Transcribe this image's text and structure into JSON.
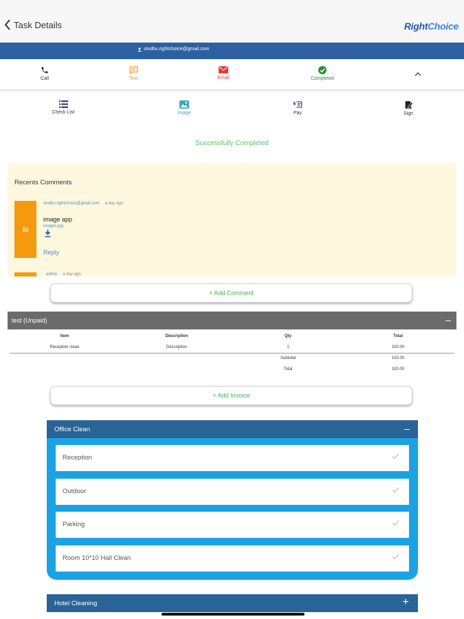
{
  "nav": {
    "back_label": "Task Details",
    "logo_part1": "Right",
    "logo_part2": "Choice"
  },
  "contact": {
    "email": "sindhu.rightchoice@gmail.com"
  },
  "actions": [
    {
      "label": "Call",
      "icon": "phone-icon",
      "color": "#333333"
    },
    {
      "label": "Text",
      "icon": "message-icon",
      "color": "#f28c1e"
    },
    {
      "label": "Email",
      "icon": "mail-icon",
      "color": "#e53935"
    },
    {
      "label": "Completed",
      "icon": "check-circle-icon",
      "color": "#2e8b3a"
    }
  ],
  "tools": [
    {
      "label": "Check List",
      "icon": "list-icon"
    },
    {
      "label": "Image",
      "icon": "image-icon",
      "active_color": "#3aa6c8"
    },
    {
      "label": "Pay",
      "icon": "pay-icon"
    },
    {
      "label": "Sign",
      "icon": "sign-icon"
    }
  ],
  "status_text": "Successfully Completed",
  "comments": {
    "title": "Recents Comments",
    "items": [
      {
        "initials": "SI",
        "author": "sindhu.rightchoice@gmail.com",
        "time": "a day ago",
        "text": "image app",
        "file": "images.jpg",
        "reply_label": "Reply"
      },
      {
        "author": "admin",
        "time": "a day ago"
      }
    ]
  },
  "add_comment_label": "+ Add Comment",
  "invoice": {
    "title": "test (Unpaid)",
    "columns": [
      "Item",
      "Description",
      "Qty",
      "Total"
    ],
    "rows": [
      {
        "item": "Reception clean",
        "description": "Description",
        "qty": "1",
        "total": "100.00"
      }
    ],
    "subtotal_label": "Subtotal",
    "subtotal_value": "100.00",
    "total_label": "Total",
    "total_value": "100.00"
  },
  "add_invoice_label": "+ Add Invoice",
  "checklists": [
    {
      "title": "Office Clean",
      "expanded": true,
      "tasks": [
        "Reception",
        "Outdoor",
        "Parking",
        "Room 10*10 Hall Clean"
      ]
    },
    {
      "title": "Hotel Cleaning",
      "expanded": false
    }
  ],
  "colors": {
    "brand_blue": "#2d5fa3",
    "panel_header": "#2a6396",
    "panel_body": "#1aa3e4",
    "success_green": "#5cbf6a",
    "comment_bg": "#fdf8de"
  }
}
